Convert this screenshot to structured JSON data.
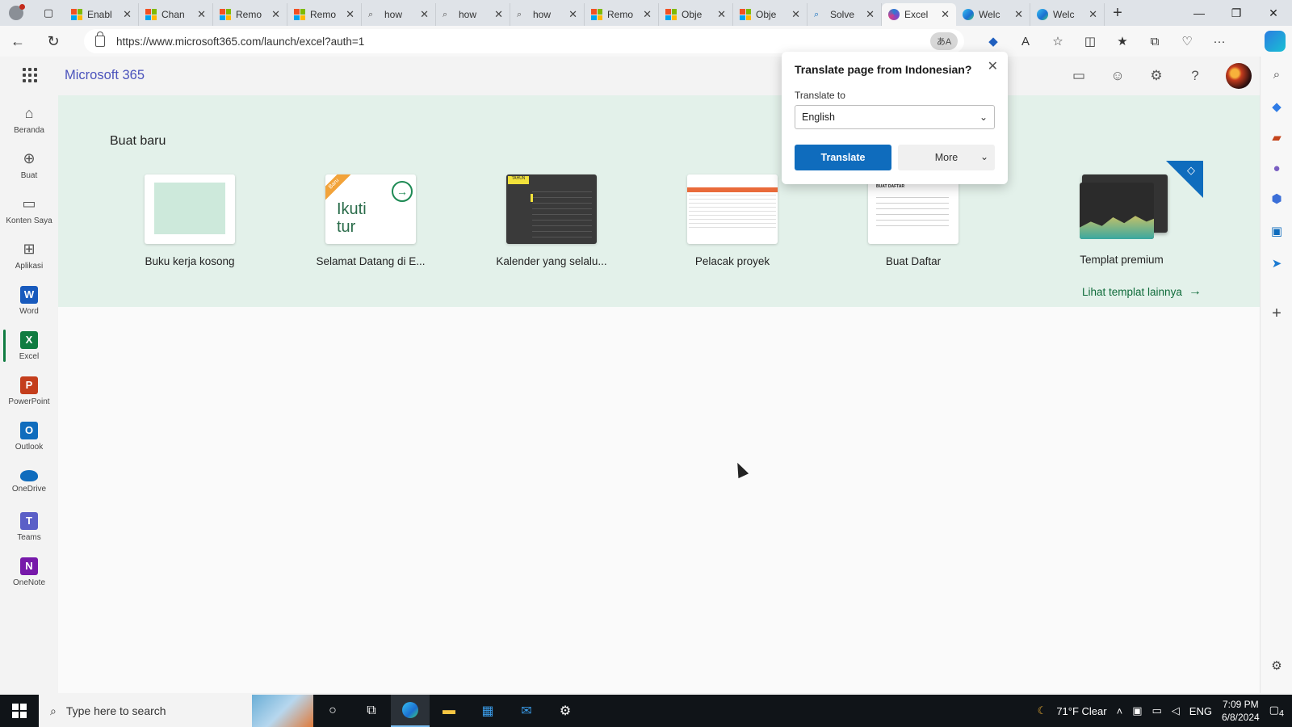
{
  "browser": {
    "tabs": [
      {
        "label": "Enabl",
        "favicon": "ms-grid"
      },
      {
        "label": "Chan",
        "favicon": "ms-grid"
      },
      {
        "label": "Remo",
        "favicon": "ms-grid"
      },
      {
        "label": "Remo",
        "favicon": "ms-grid"
      },
      {
        "label": "how",
        "favicon": "search"
      },
      {
        "label": "how",
        "favicon": "search"
      },
      {
        "label": "how",
        "favicon": "search"
      },
      {
        "label": "Remo",
        "favicon": "ms-grid"
      },
      {
        "label": "Obje",
        "favicon": "ms-grid"
      },
      {
        "label": "Obje",
        "favicon": "ms-grid"
      },
      {
        "label": "Solve",
        "favicon": "search-blue"
      },
      {
        "label": "Excel",
        "favicon": "m365",
        "active": true
      },
      {
        "label": "Welc",
        "favicon": "edge"
      },
      {
        "label": "Welc",
        "favicon": "edge"
      }
    ],
    "url": "https://www.microsoft365.com/launch/excel?auth=1",
    "translate_badge": "あA"
  },
  "header": {
    "brand": "Microsoft 365"
  },
  "rail": [
    {
      "label": "Beranda",
      "icon": "home-icon"
    },
    {
      "label": "Buat",
      "icon": "plus-circle-icon"
    },
    {
      "label": "Konten Saya",
      "icon": "folder-icon"
    },
    {
      "label": "Aplikasi",
      "icon": "apps-icon"
    },
    {
      "label": "Word",
      "icon": "word-icon",
      "letter": "W",
      "color": "#185abd"
    },
    {
      "label": "Excel",
      "icon": "excel-icon",
      "letter": "X",
      "color": "#107c41",
      "active": true
    },
    {
      "label": "PowerPoint",
      "icon": "powerpoint-icon",
      "letter": "P",
      "color": "#c43e1c"
    },
    {
      "label": "Outlook",
      "icon": "outlook-icon",
      "letter": "O",
      "color": "#0f6cbd"
    },
    {
      "label": "OneDrive",
      "icon": "onedrive-icon",
      "color": "#0f6cbd"
    },
    {
      "label": "Teams",
      "icon": "teams-icon",
      "letter": "T",
      "color": "#5b5fc7"
    },
    {
      "label": "OneNote",
      "icon": "onenote-icon",
      "letter": "N",
      "color": "#7719aa"
    }
  ],
  "create": {
    "title": "Buat baru",
    "tiles": [
      {
        "label": "Buku kerja kosong"
      },
      {
        "label": "Selamat Datang di E...",
        "badge": "Baru",
        "thumb_text": "Ikuti tur"
      },
      {
        "label": "Kalender yang selalu...",
        "thumb_head": "TAHUN"
      },
      {
        "label": "Pelacak proyek"
      },
      {
        "label": "Buat Daftar",
        "thumb_head": "BUAT DAFTAR"
      },
      {
        "label": "Templat premium"
      }
    ],
    "more_link": "Lihat templat lainnya"
  },
  "translate_popup": {
    "title": "Translate page from Indonesian?",
    "translate_to_label": "Translate to",
    "selected_language": "English",
    "translate_button": "Translate",
    "more_button": "More"
  },
  "taskbar": {
    "search_placeholder": "Type here to search",
    "weather": "71°F  Clear",
    "language": "ENG",
    "time": "7:09 PM",
    "date": "6/8/2024",
    "notification_count": "4"
  }
}
